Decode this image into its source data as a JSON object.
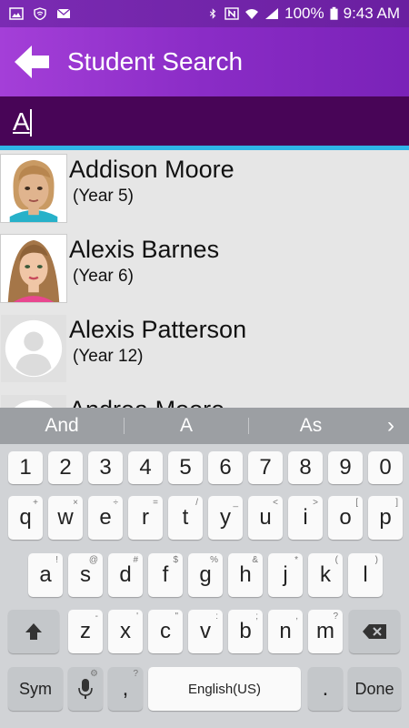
{
  "status_bar": {
    "battery": "100%",
    "time": "9:43 AM"
  },
  "app_bar": {
    "title": "Student Search"
  },
  "search": {
    "value": "A"
  },
  "students": [
    {
      "name": "Addison Moore",
      "year": "(Year 5)",
      "avatar": "girl-short-hair"
    },
    {
      "name": "Alexis Barnes",
      "year": "(Year 6)",
      "avatar": "girl-long-hair"
    },
    {
      "name": "Alexis Patterson",
      "year": "(Year 12)",
      "avatar": "default-person"
    },
    {
      "name": "Andrea Moore",
      "year": "",
      "avatar": "default-person"
    }
  ],
  "keyboard": {
    "suggestions": [
      "And",
      "A",
      "As"
    ],
    "number_row": [
      "1",
      "2",
      "3",
      "4",
      "5",
      "6",
      "7",
      "8",
      "9",
      "0"
    ],
    "row1": [
      [
        "q",
        "+"
      ],
      [
        "w",
        "×"
      ],
      [
        "e",
        "÷"
      ],
      [
        "r",
        "="
      ],
      [
        "t",
        "/"
      ],
      [
        "y",
        "_"
      ],
      [
        "u",
        "<"
      ],
      [
        "i",
        ">"
      ],
      [
        "o",
        "["
      ],
      [
        "p",
        "]"
      ]
    ],
    "row2": [
      [
        "a",
        "!"
      ],
      [
        "s",
        "@"
      ],
      [
        "d",
        "#"
      ],
      [
        "f",
        "$"
      ],
      [
        "g",
        "%"
      ],
      [
        "h",
        "&"
      ],
      [
        "j",
        "*"
      ],
      [
        "k",
        "("
      ],
      [
        "l",
        ")"
      ]
    ],
    "row3": [
      [
        "z",
        "-"
      ],
      [
        "x",
        "'"
      ],
      [
        "c",
        "\""
      ],
      [
        "v",
        ":"
      ],
      [
        "b",
        ";"
      ],
      [
        "n",
        ","
      ],
      [
        "m",
        "?"
      ]
    ],
    "sym_label": "Sym",
    "comma_label": ",",
    "comma_sub": "?",
    "space_label": "English(US)",
    "period_label": ".",
    "done_label": "Done"
  },
  "colors": {
    "app_bar": "#9b36d0",
    "search_bar": "#480557",
    "accent": "#2fb5e8"
  }
}
